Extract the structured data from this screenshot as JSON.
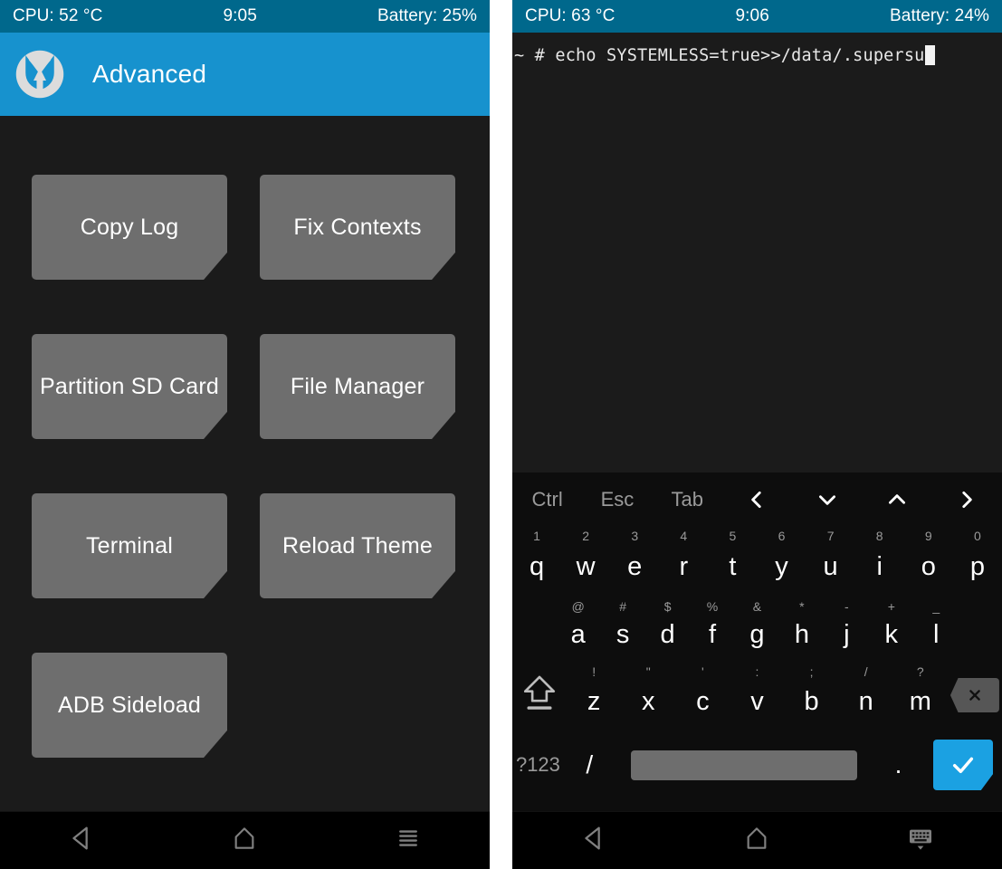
{
  "left_screen": {
    "status_bar": {
      "cpu": "CPU: 52 °C",
      "time": "9:05",
      "battery": "Battery: 25%"
    },
    "action_bar": {
      "title": "Advanced",
      "logo_icon": "twrp-logo-icon"
    },
    "buttons": [
      {
        "label": "Copy Log"
      },
      {
        "label": "Fix Contexts"
      },
      {
        "label": "Partition SD Card"
      },
      {
        "label": "File Manager"
      },
      {
        "label": "Terminal"
      },
      {
        "label": "Reload Theme"
      },
      {
        "label": "ADB Sideload"
      }
    ],
    "nav_bar": [
      {
        "icon": "back-icon"
      },
      {
        "icon": "home-icon"
      },
      {
        "icon": "menu-icon"
      }
    ]
  },
  "right_screen": {
    "status_bar": {
      "cpu": "CPU: 63 °C",
      "time": "9:06",
      "battery": "Battery: 24%"
    },
    "terminal": {
      "prompt": "~ # ",
      "command": "echo SYSTEMLESS=true>>/data/.supersu",
      "full_line": "~ # echo SYSTEMLESS=true>>/data/.supersu"
    },
    "keyboard": {
      "function_row": [
        {
          "label": "Ctrl",
          "name": "ctrl"
        },
        {
          "label": "Esc",
          "name": "esc"
        },
        {
          "label": "Tab",
          "name": "tab"
        },
        {
          "label": "‹",
          "name": "arrow-left"
        },
        {
          "label": "⌄",
          "name": "arrow-down"
        },
        {
          "label": "⌃",
          "name": "arrow-up"
        },
        {
          "label": "›",
          "name": "arrow-right"
        }
      ],
      "row1": [
        {
          "key": "q",
          "sub": "1"
        },
        {
          "key": "w",
          "sub": "2"
        },
        {
          "key": "e",
          "sub": "3"
        },
        {
          "key": "r",
          "sub": "4"
        },
        {
          "key": "t",
          "sub": "5"
        },
        {
          "key": "y",
          "sub": "6"
        },
        {
          "key": "u",
          "sub": "7"
        },
        {
          "key": "i",
          "sub": "8"
        },
        {
          "key": "o",
          "sub": "9"
        },
        {
          "key": "p",
          "sub": "0"
        }
      ],
      "row2": [
        {
          "key": "a",
          "sub": "@"
        },
        {
          "key": "s",
          "sub": "#"
        },
        {
          "key": "d",
          "sub": "$"
        },
        {
          "key": "f",
          "sub": "%"
        },
        {
          "key": "g",
          "sub": "&"
        },
        {
          "key": "h",
          "sub": "*"
        },
        {
          "key": "j",
          "sub": "-"
        },
        {
          "key": "k",
          "sub": "+"
        },
        {
          "key": "l",
          "sub": "_"
        }
      ],
      "row3": [
        {
          "key": "z",
          "sub": "!"
        },
        {
          "key": "x",
          "sub": "\""
        },
        {
          "key": "c",
          "sub": "'"
        },
        {
          "key": "v",
          "sub": ":"
        },
        {
          "key": "b",
          "sub": ";"
        },
        {
          "key": "n",
          "sub": "/"
        },
        {
          "key": "m",
          "sub": "?"
        }
      ],
      "shift_icon": "shift-icon",
      "backspace_icon": "backspace-icon",
      "bottom_row": {
        "symbols_label": "?123",
        "slash_label": "/",
        "space_label": "",
        "period_label": ".",
        "enter_icon": "check-icon"
      }
    },
    "nav_bar": [
      {
        "icon": "back-icon"
      },
      {
        "icon": "home-icon"
      },
      {
        "icon": "hide-keyboard-icon"
      }
    ]
  },
  "colors": {
    "status_bar": "#00688c",
    "action_bar": "#1792ce",
    "accent": "#1ba1e2",
    "button": "#6e6e6e",
    "background": "#1b1b1b",
    "keyboard_bg": "#0d0d0d",
    "nav_bg": "#000000"
  }
}
